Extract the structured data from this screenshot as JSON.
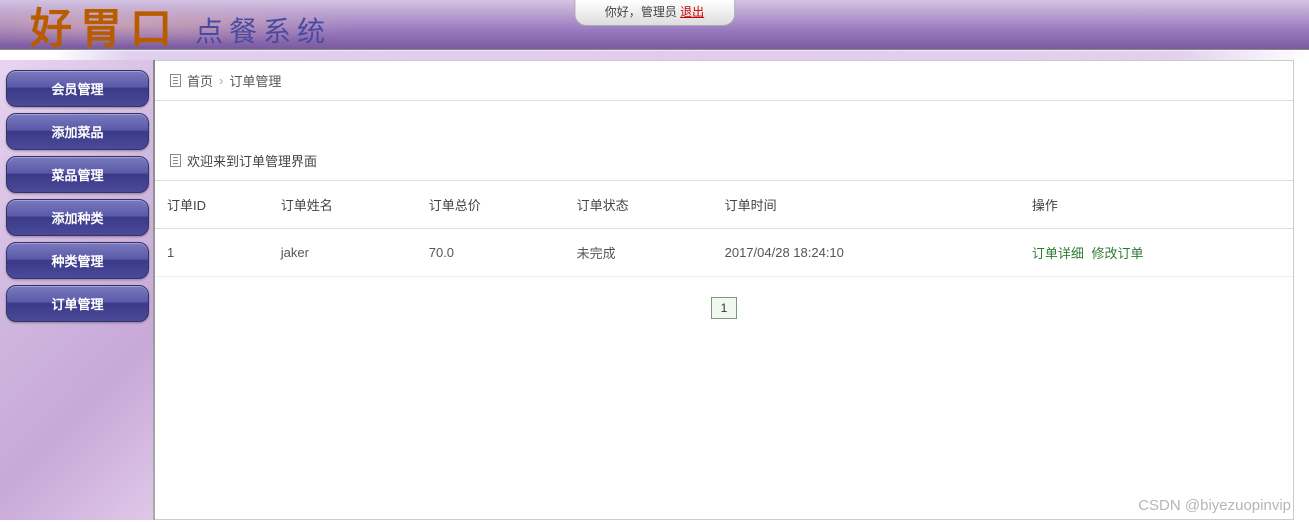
{
  "header": {
    "logo_main": "好胃口",
    "logo_sub": "点餐系统",
    "greeting": "你好，",
    "role": "管理员",
    "logout": "退出"
  },
  "sidebar": {
    "items": [
      {
        "label": "会员管理"
      },
      {
        "label": "添加菜品"
      },
      {
        "label": "菜品管理"
      },
      {
        "label": "添加种类"
      },
      {
        "label": "种类管理"
      },
      {
        "label": "订单管理"
      }
    ]
  },
  "breadcrumb": {
    "home": "首页",
    "current": "订单管理"
  },
  "welcome": "欢迎来到订单管理界面",
  "table": {
    "headers": {
      "id": "订单ID",
      "name": "订单姓名",
      "total": "订单总价",
      "status": "订单状态",
      "time": "订单时间",
      "ops": "操作"
    },
    "rows": [
      {
        "id": "1",
        "name": "jaker",
        "total": "70.0",
        "status": "未完成",
        "time": "2017/04/28 18:24:10",
        "op_detail": "订单详细",
        "op_edit": "修改订单"
      }
    ]
  },
  "pager": {
    "current": "1"
  },
  "watermark": "CSDN @biyezuopinvip"
}
